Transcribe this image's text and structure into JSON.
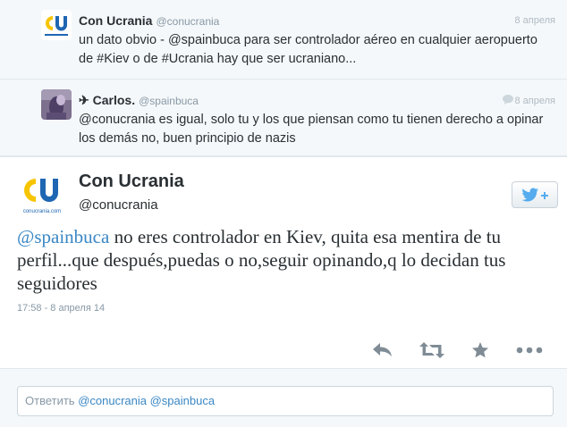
{
  "context_tweets": [
    {
      "fullname": "Con Ucrania",
      "screen_name": "@conucrania",
      "date": "8 апреля",
      "text": "un dato obvio - @spainbuca para ser controlador aéreo en cualquier aeropuerto de #Kiev o de #Ucrania hay que ser ucraniano..."
    },
    {
      "reply_marker": "✈",
      "fullname": "Carlos.",
      "screen_name": "@spainbuca",
      "date": "8 апреля",
      "text": "@conucrania es igual, solo tu y los que piensan como tu tienen derecho a opinar los demás no, buen principio de nazis"
    }
  ],
  "main_tweet": {
    "fullname": "Con Ucrania",
    "screen_name": "@conucrania",
    "avatar_text": "CU",
    "avatar_caption": "conucrania.com",
    "mention": "@spainbuca",
    "text": " no eres controlador en Kiev, quita esa mentira de tu perfil...que después,puedas o no,seguir opinando,q lo decidan tus seguidores",
    "timestamp": "17:58 - 8 апреля 14"
  },
  "reply_box": {
    "prefix": "Ответить ",
    "handles": "@conucrania @spainbuca"
  },
  "colors": {
    "link": "#3a87c4",
    "bird": "#55acee",
    "logo_blue": "#1f66b3",
    "logo_yellow": "#f7c500"
  }
}
